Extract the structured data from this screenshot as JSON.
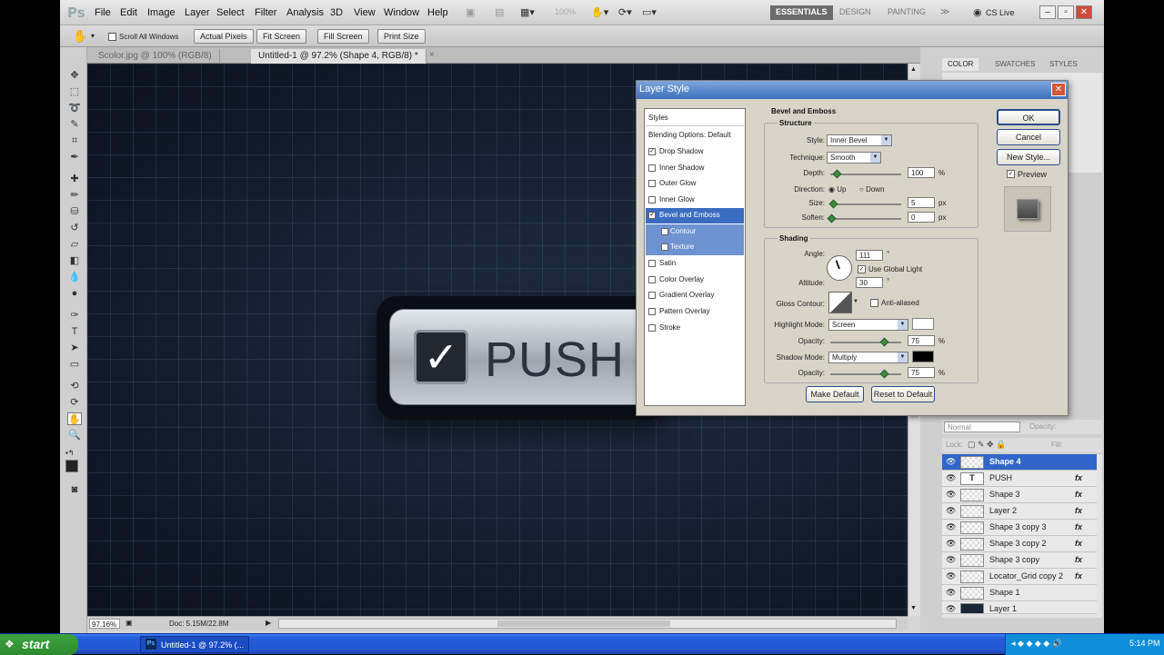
{
  "app": {
    "logo": "Ps",
    "menus": [
      "File",
      "Edit",
      "Image",
      "Layer",
      "Select",
      "Filter",
      "Analysis",
      "3D",
      "View",
      "Window",
      "Help"
    ],
    "zoom": "100%",
    "workspaces": [
      "ESSENTIALS",
      "DESIGN",
      "PAINTING"
    ],
    "cs_live": "CS Live"
  },
  "options_bar": {
    "scroll_all": "Scroll All Windows",
    "buttons": [
      "Actual Pixels",
      "Fit Screen",
      "Fill Screen",
      "Print Size"
    ]
  },
  "doc_tabs": [
    "Scolor.jpg @ 100% (RGB/8)",
    "Untitled-1 @ 97.2% (Shape 4, RGB/8) *"
  ],
  "canvas": {
    "push_label": "PUSH"
  },
  "status": {
    "zoom": "97.16%",
    "doc": "Doc: 5.15M/22.8M"
  },
  "right_panel": {
    "tabs": [
      "COLOR",
      "SWATCHES",
      "STYLES"
    ],
    "blend_mode": "Normal",
    "opacity_label": "Opacity:",
    "lock_label": "Lock:",
    "fill_label": "Fill:",
    "layers": [
      {
        "name": "Shape 4",
        "fx": "",
        "selected": true
      },
      {
        "name": "PUSH",
        "fx": "fx",
        "selected": false
      },
      {
        "name": "Shape 3",
        "fx": "fx",
        "selected": false
      },
      {
        "name": "Layer 2",
        "fx": "fx",
        "selected": false
      },
      {
        "name": "Shape 3 copy 3",
        "fx": "fx",
        "selected": false
      },
      {
        "name": "Shape 3 copy 2",
        "fx": "fx",
        "selected": false
      },
      {
        "name": "Shape 3 copy",
        "fx": "fx",
        "selected": false
      },
      {
        "name": "Locator_Grid copy 2",
        "fx": "fx",
        "selected": false
      },
      {
        "name": "Shape 1",
        "fx": "",
        "selected": false
      },
      {
        "name": "Layer 1",
        "fx": "",
        "selected": false
      }
    ]
  },
  "dialog": {
    "title": "Layer Style",
    "styles_header": "Styles",
    "blending": "Blending Options: Default",
    "styles": [
      {
        "label": "Drop Shadow",
        "checked": true
      },
      {
        "label": "Inner Shadow",
        "checked": false
      },
      {
        "label": "Outer Glow",
        "checked": false
      },
      {
        "label": "Inner Glow",
        "checked": false
      },
      {
        "label": "Bevel and Emboss",
        "checked": true
      },
      {
        "label": "Contour",
        "checked": false
      },
      {
        "label": "Texture",
        "checked": false
      },
      {
        "label": "Satin",
        "checked": false
      },
      {
        "label": "Color Overlay",
        "checked": false
      },
      {
        "label": "Gradient Overlay",
        "checked": false
      },
      {
        "label": "Pattern Overlay",
        "checked": false
      },
      {
        "label": "Stroke",
        "checked": false
      }
    ],
    "section_title": "Bevel and Emboss",
    "structure": {
      "title": "Structure",
      "style_label": "Style:",
      "style_value": "Inner Bevel",
      "technique_label": "Technique:",
      "technique_value": "Smooth",
      "depth_label": "Depth:",
      "depth_value": "100",
      "depth_unit": "%",
      "direction_label": "Direction:",
      "dir_up": "Up",
      "dir_down": "Down",
      "size_label": "Size:",
      "size_value": "5",
      "size_unit": "px",
      "soften_label": "Soften:",
      "soften_value": "0",
      "soften_unit": "px"
    },
    "shading": {
      "title": "Shading",
      "angle_label": "Angle:",
      "angle_value": "111",
      "degree": "°",
      "global_light": "Use Global Light",
      "altitude_label": "Altitude:",
      "altitude_value": "30",
      "gloss_label": "Gloss Contour:",
      "anti_aliased": "Anti-aliased",
      "highlight_label": "Highlight Mode:",
      "highlight_value": "Screen",
      "opacity_label": "Opacity:",
      "highlight_opacity": "75",
      "shadow_label": "Shadow Mode:",
      "shadow_value": "Multiply",
      "shadow_opacity": "75",
      "pct": "%"
    },
    "make_default": "Make Default",
    "reset_default": "Reset to Default",
    "ok": "OK",
    "cancel": "Cancel",
    "new_style": "New Style...",
    "preview": "Preview"
  },
  "taskbar": {
    "start": "start",
    "item": "Untitled-1 @ 97.2% (...",
    "clock": "5:14 PM"
  }
}
